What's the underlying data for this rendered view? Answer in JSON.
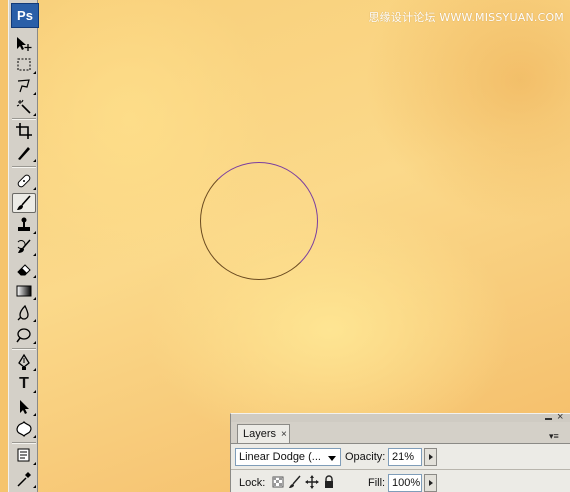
{
  "watermark": "思缘设计论坛 WWW.MISSYUAN.COM",
  "toolbar": {
    "logo": "Ps",
    "tools": [
      {
        "name": "move-tool",
        "icon": "move-icon"
      },
      {
        "name": "marquee-tool",
        "icon": "marquee-icon"
      },
      {
        "name": "lasso-tool",
        "icon": "lasso-icon"
      },
      {
        "name": "magic-wand-tool",
        "icon": "magic-wand-icon"
      },
      {
        "name": "crop-tool",
        "icon": "crop-icon"
      },
      {
        "name": "slice-tool",
        "icon": "slice-icon"
      },
      {
        "name": "healing-brush-tool",
        "icon": "bandage-icon"
      },
      {
        "name": "brush-tool",
        "icon": "brush-icon",
        "active": true
      },
      {
        "name": "clone-stamp-tool",
        "icon": "stamp-icon"
      },
      {
        "name": "history-brush-tool",
        "icon": "history-brush-icon"
      },
      {
        "name": "eraser-tool",
        "icon": "eraser-icon"
      },
      {
        "name": "gradient-tool",
        "icon": "gradient-icon"
      },
      {
        "name": "blur-tool",
        "icon": "blur-icon"
      },
      {
        "name": "dodge-tool",
        "icon": "dodge-icon"
      },
      {
        "name": "pen-tool",
        "icon": "pen-icon"
      },
      {
        "name": "type-tool",
        "icon": "type-icon",
        "glyph": "T"
      },
      {
        "name": "path-selection-tool",
        "icon": "arrow-icon"
      },
      {
        "name": "custom-shape-tool",
        "icon": "shape-icon"
      },
      {
        "name": "notes-tool",
        "icon": "notes-icon"
      },
      {
        "name": "eyedropper-tool",
        "icon": "eyedropper-icon"
      }
    ]
  },
  "layers_panel": {
    "tab_label": "Layers",
    "tab_close": "×",
    "close_glyph": "×",
    "blend_mode": "Linear Dodge (...",
    "opacity_label": "Opacity:",
    "opacity_value": "21%",
    "lock_label": "Lock:",
    "fill_label": "Fill:",
    "fill_value": "100%",
    "menu_glyph": "▾≡"
  },
  "colors": {
    "canvas_base": "#f8cf7a",
    "toolbar_bg": "#d4d0c8",
    "panel_bg": "#ecebe6",
    "ps_logo": "#2a5fa8"
  }
}
